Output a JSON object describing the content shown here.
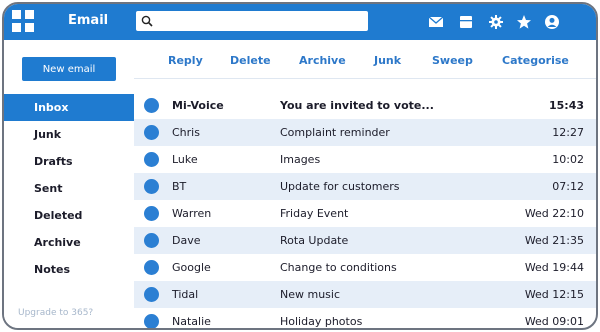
{
  "app": {
    "title": "Email",
    "logo_icon": "grid-logo-icon"
  },
  "search": {
    "placeholder": "",
    "value": "",
    "icon": "search-icon"
  },
  "top_icons": [
    "envelope-icon",
    "calendar-icon",
    "gear-icon",
    "star-icon",
    "user-icon"
  ],
  "sidebar": {
    "new_email_label": "New email",
    "items": [
      {
        "label": "Inbox",
        "active": true
      },
      {
        "label": "Junk"
      },
      {
        "label": "Drafts"
      },
      {
        "label": "Sent"
      },
      {
        "label": "Deleted"
      },
      {
        "label": "Archive"
      },
      {
        "label": "Notes"
      }
    ],
    "upgrade_label": "Upgrade to 365?"
  },
  "toolbar": {
    "reply": "Reply",
    "delete": "Delete",
    "archive": "Archive",
    "junk": "Junk",
    "sweep": "Sweep",
    "categorise": "Categorise"
  },
  "messages": [
    {
      "sender": "Mi-Voice",
      "subject": "You are invited to vote...",
      "time": "15:43",
      "unread": true
    },
    {
      "sender": "Chris",
      "subject": "Complaint reminder",
      "time": "12:27"
    },
    {
      "sender": "Luke",
      "subject": "Images",
      "time": "10:02"
    },
    {
      "sender": "BT",
      "subject": "Update for customers",
      "time": "07:12"
    },
    {
      "sender": "Warren",
      "subject": "Friday Event",
      "time": "Wed 22:10"
    },
    {
      "sender": "Dave",
      "subject": "Rota Update",
      "time": "Wed 21:35"
    },
    {
      "sender": "Google",
      "subject": "Change to conditions",
      "time": "Wed 19:44"
    },
    {
      "sender": "Tidal",
      "subject": "New music",
      "time": "Wed 12:15"
    },
    {
      "sender": "Natalie",
      "subject": "Holiday photos",
      "time": "Wed 09:01"
    }
  ],
  "colors": {
    "accent": "#1f7bd0",
    "row_shade": "#e6eef8",
    "unread_dot": "#2b7fd3",
    "upgrade_text": "#a7b7cb"
  }
}
